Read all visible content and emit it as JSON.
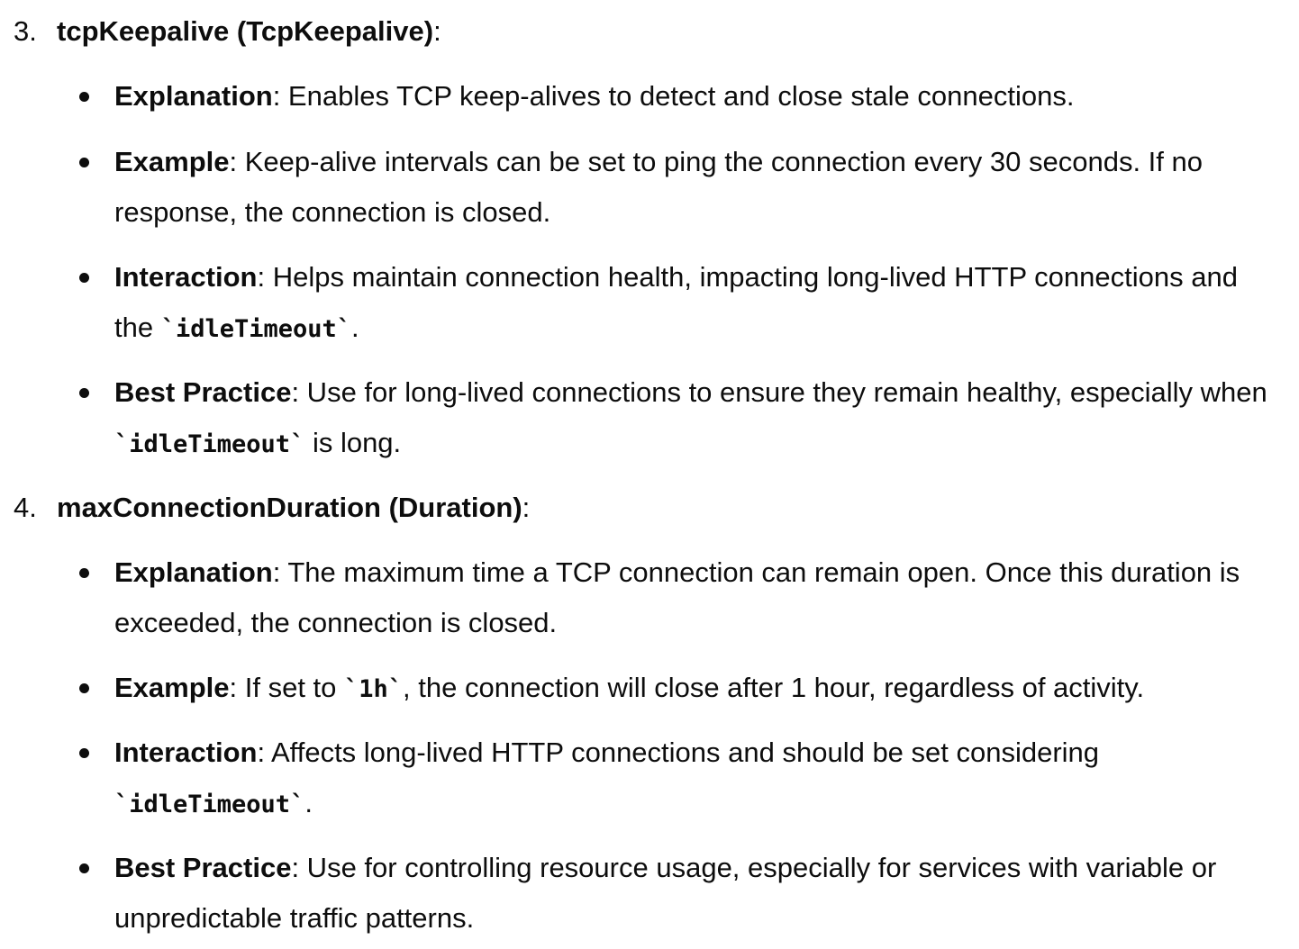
{
  "sections": [
    {
      "number": "3.",
      "title": "tcpKeepalive (TcpKeepalive)",
      "colon": ":",
      "items": [
        {
          "label": "Explanation",
          "parts": [
            ": Enables TCP keep-alives to detect and close stale connections."
          ]
        },
        {
          "label": "Example",
          "parts": [
            ": Keep-alive intervals can be set to ping the connection every 30 seconds. If no response, the connection is closed."
          ]
        },
        {
          "label": "Interaction",
          "parts": [
            ": Helps maintain connection health, impacting long-lived HTTP connections and the ",
            "`idleTimeout`",
            "."
          ]
        },
        {
          "label": "Best Practice",
          "parts": [
            ": Use for long-lived connections to ensure they remain healthy, especially when ",
            "`idleTimeout`",
            " is long."
          ]
        }
      ]
    },
    {
      "number": "4.",
      "title": "maxConnectionDuration (Duration)",
      "colon": ":",
      "items": [
        {
          "label": "Explanation",
          "parts": [
            ": The maximum time a TCP connection can remain open. Once this duration is exceeded, the connection is closed."
          ]
        },
        {
          "label": "Example",
          "parts": [
            ": If set to ",
            "`1h`",
            ", the connection will close after 1 hour, regardless of activity."
          ]
        },
        {
          "label": "Interaction",
          "parts": [
            ": Affects long-lived HTTP connections and should be set considering ",
            "`idleTimeout`",
            "."
          ]
        },
        {
          "label": "Best Practice",
          "parts": [
            ": Use for controlling resource usage, especially for services with variable or unpredictable traffic patterns."
          ]
        }
      ]
    }
  ]
}
